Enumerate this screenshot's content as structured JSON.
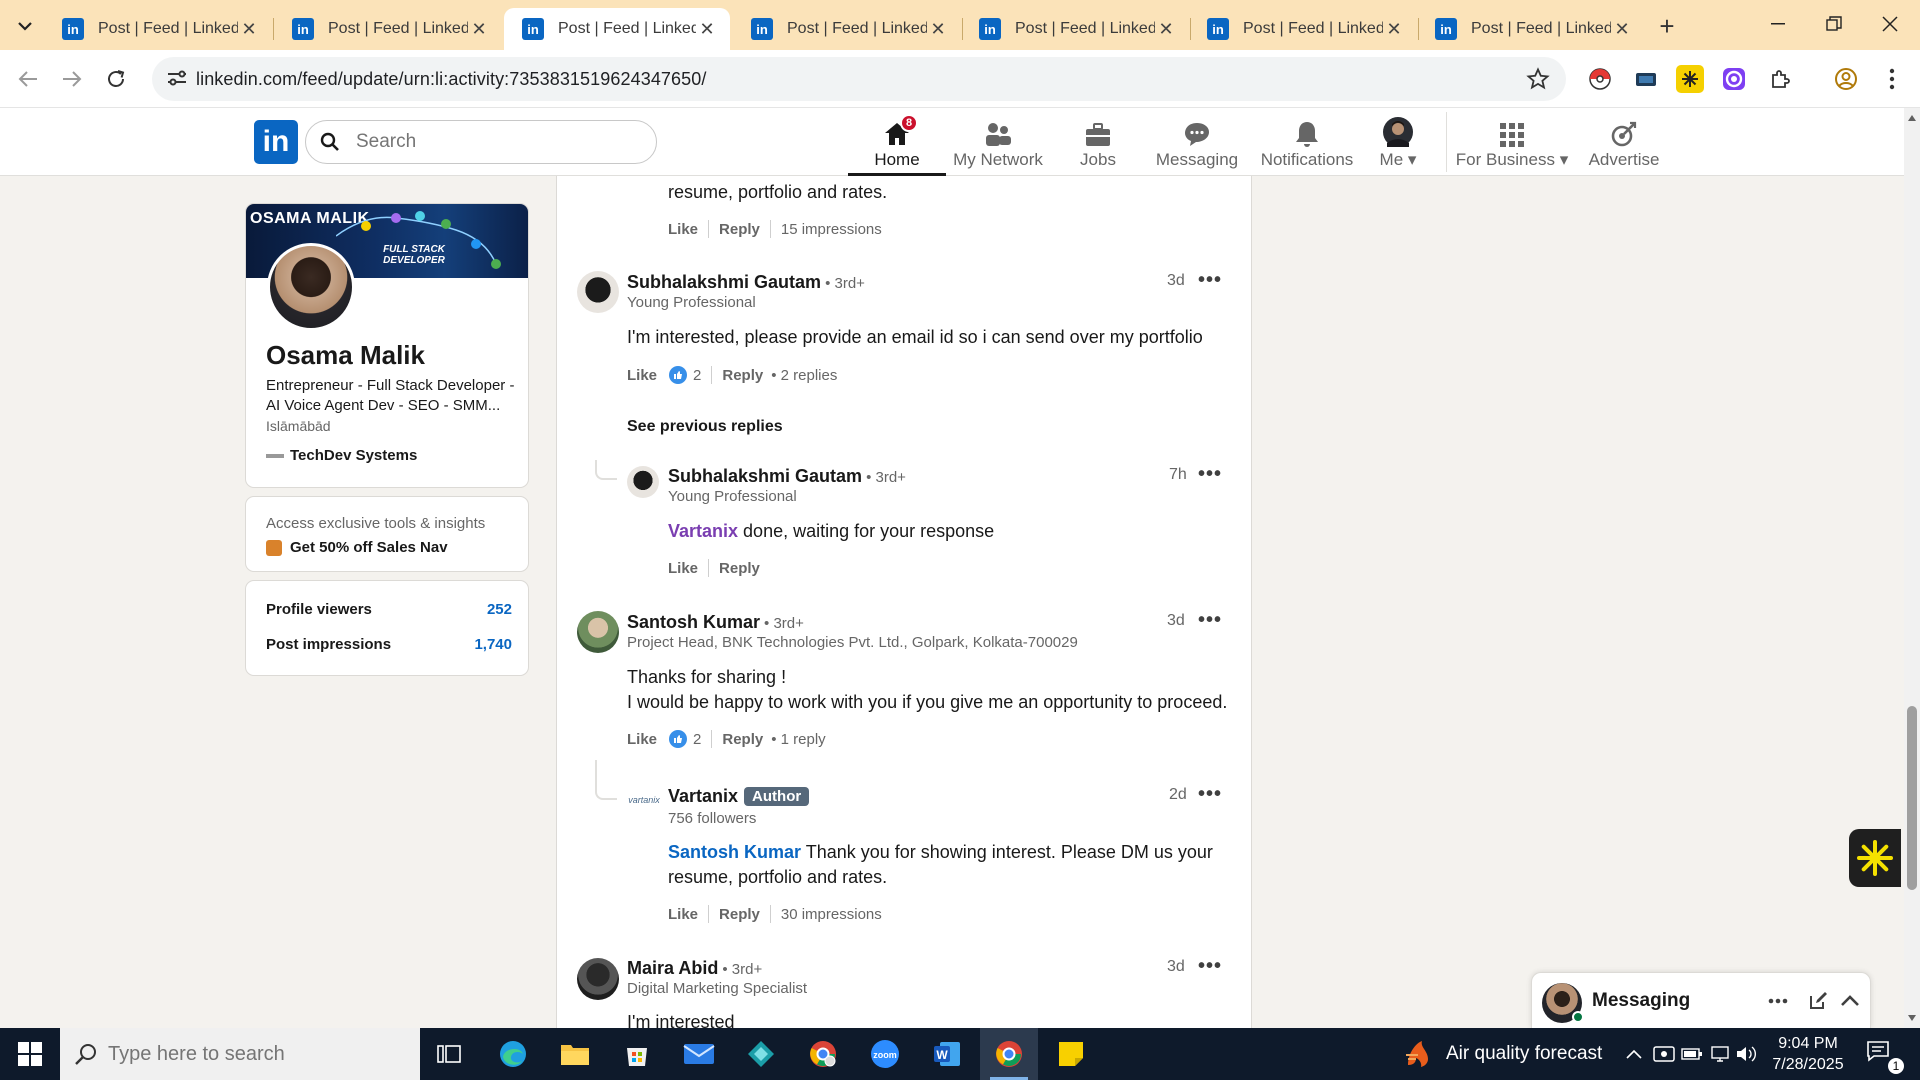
{
  "browser": {
    "tabs": [
      {
        "title": "Post | Feed | LinkedIn"
      },
      {
        "title": "Post | Feed | LinkedIn"
      },
      {
        "title": "Post | Feed | LinkedIn"
      },
      {
        "title": "Post | Feed | LinkedIn"
      },
      {
        "title": "Post | Feed | LinkedIn"
      },
      {
        "title": "Post | Feed | LinkedIn"
      },
      {
        "title": "Post | Feed | LinkedIn"
      }
    ],
    "active_tab": 2,
    "favicon_letters": "in",
    "tab_close": "✕",
    "new_tab": "+",
    "url": "linkedin.com/feed/update/urn:li:activity:7353831519624347650/"
  },
  "linkedin": {
    "logo": "in",
    "search_placeholder": "Search",
    "nav": [
      {
        "label": "Home"
      },
      {
        "label": "My Network"
      },
      {
        "label": "Jobs"
      },
      {
        "label": "Messaging"
      },
      {
        "label": "Notifications"
      },
      {
        "label": "Me"
      },
      {
        "label": "For Business"
      },
      {
        "label": "Advertise"
      }
    ],
    "notification_badge": "8"
  },
  "profile": {
    "banner_name": "OSAMA MALIK",
    "banner_title": "FULL STACK DEVELOPER",
    "name": "Osama Malik",
    "headline": "Entrepreneur - Full Stack Developer - AI Voice Agent Dev - SEO - SMM...",
    "location": "Islāmābād",
    "company": "TechDev Systems",
    "promo_text": "Access exclusive tools & insights",
    "promo_link": "Get 50% off Sales Nav",
    "stats": [
      {
        "label": "Profile viewers",
        "value": "252"
      },
      {
        "label": "Post impressions",
        "value": "1,740"
      }
    ]
  },
  "comments": {
    "top_fragment": {
      "text": "resume, portfolio and rates.",
      "like": "Like",
      "reply": "Reply",
      "impressions": "15 impressions"
    },
    "c1": {
      "name": "Subhalakshmi Gautam",
      "degree": "• 3rd+",
      "subtitle": "Young Professional",
      "time": "3d",
      "text": "I'm interested, please provide an email id so i can send over my portfolio",
      "like": "Like",
      "reactions": "2",
      "reply": "Reply",
      "replies": "2 replies"
    },
    "see_previous": "See previous replies",
    "r1": {
      "name": "Subhalakshmi Gautam",
      "degree": "• 3rd+",
      "subtitle": "Young Professional",
      "time": "7h",
      "mention": "Vartanix",
      "text": " done, waiting for your response",
      "like": "Like",
      "reply": "Reply"
    },
    "c2": {
      "name": "Santosh Kumar",
      "degree": "• 3rd+",
      "subtitle": "Project Head, BNK Technologies Pvt. Ltd., Golpark, Kolkata-700029",
      "time": "3d",
      "text_line1": "Thanks for sharing !",
      "text_line2": "I would be happy to work with you if you give me an opportunity to proceed.",
      "like": "Like",
      "reactions": "2",
      "reply": "Reply",
      "replies": "1 reply"
    },
    "r2": {
      "name": "Vartanix",
      "badge": "Author",
      "subtitle": "756 followers",
      "time": "2d",
      "logo_text": "vartanix",
      "mention": "Santosh Kumar",
      "text": " Thank you for showing interest. Please DM us your",
      "text_line2": "resume, portfolio and rates.",
      "like": "Like",
      "reply": "Reply",
      "impressions": "30 impressions"
    },
    "c3": {
      "name": "Maira Abid",
      "degree": "• 3rd+",
      "subtitle": "Digital Marketing Specialist",
      "time": "3d",
      "text": "I'm interested"
    },
    "more_glyph": "•••"
  },
  "messaging": {
    "title": "Messaging"
  },
  "taskbar": {
    "search_placeholder": "Type here to search",
    "weather": "Air quality forecast",
    "time": "9:04 PM",
    "date": "7/28/2025",
    "notification_count": "1"
  },
  "colors": {
    "linkedin_blue": "#0a66c2",
    "tabstrip": "#fbe3b9",
    "taskbar": "#0e1a2b"
  }
}
